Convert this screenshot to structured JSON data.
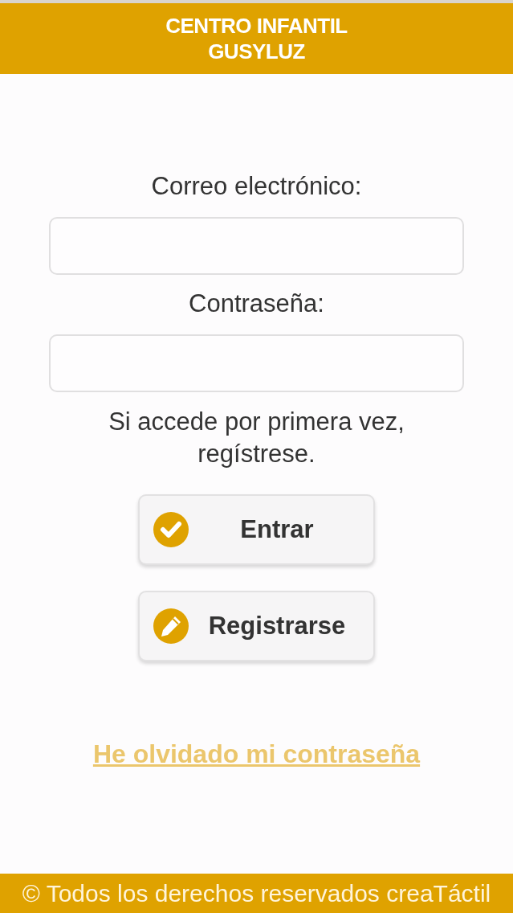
{
  "header": {
    "title": "CENTRO INFANTIL GUSYLUZ"
  },
  "fields": [
    {
      "label": "Correo electrónico:"
    },
    {
      "label": "Contraseña:"
    }
  ],
  "notice": "Si accede por primera vez, regístrese.",
  "buttons": [
    {
      "label": "Entrar",
      "kind": "login"
    },
    {
      "label": "Registrarse",
      "kind": "register"
    }
  ],
  "forgot_link": {
    "label": "He olvidado mi contraseña"
  },
  "footer": {
    "text": "© Todos los derechos reservados creaTáctil"
  }
}
